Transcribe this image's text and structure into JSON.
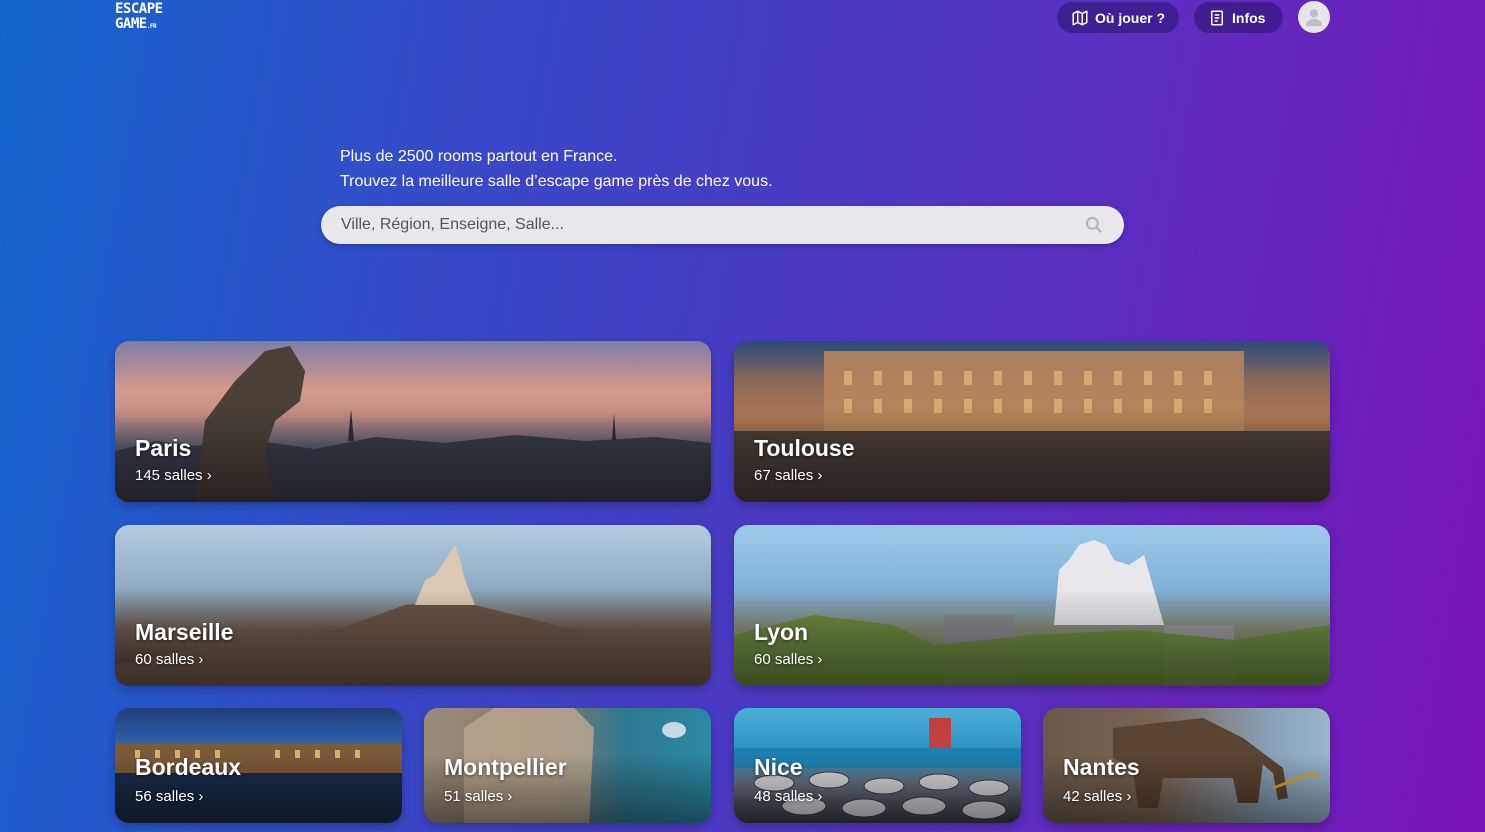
{
  "header": {
    "logo_line1": "ESCAPE",
    "logo_line2": "GAME",
    "logo_tld": ".FR",
    "nav_where": "Où jouer ?",
    "nav_infos": "Infos"
  },
  "hero": {
    "line1": "Plus de 2500 rooms partout en France.",
    "line2": "Trouvez la meilleure salle d’escape game près de chez vous.",
    "search_placeholder": "Ville, Région, Enseigne, Salle..."
  },
  "cities": [
    {
      "name": "Paris",
      "count": "145 salles"
    },
    {
      "name": "Toulouse",
      "count": "67 salles"
    },
    {
      "name": "Marseille",
      "count": "60 salles"
    },
    {
      "name": "Lyon",
      "count": "60 salles"
    },
    {
      "name": "Bordeaux",
      "count": "56 salles"
    },
    {
      "name": "Montpellier",
      "count": "51 salles"
    },
    {
      "name": "Nice",
      "count": "48 salles"
    },
    {
      "name": "Nantes",
      "count": "42 salles"
    }
  ],
  "icons": {
    "map": "map-icon",
    "infos": "document-icon",
    "avatar": "user-avatar-icon",
    "search": "search-icon",
    "chevron": "chevron-right-icon"
  }
}
